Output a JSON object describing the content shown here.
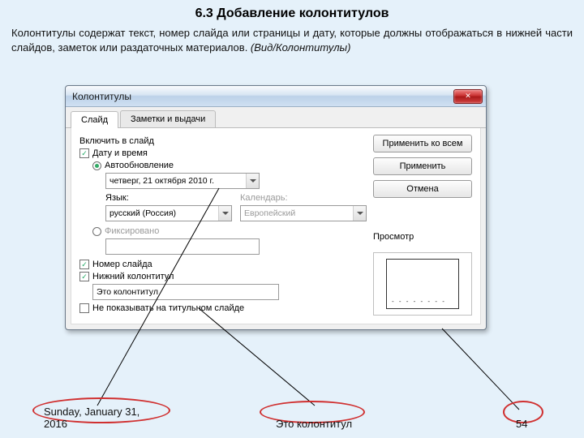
{
  "heading": "6.3 Добавление колонтитулов",
  "description": "Колонтитулы содержат текст, номер слайда или страницы и дату, которые должны отображаться в нижней части слайдов, заметок или раздаточных материалов. ",
  "ital": "(Вид/Колонтитулы)",
  "dialog": {
    "title": "Колонтитулы",
    "tabs": [
      "Слайд",
      "Заметки и выдачи"
    ],
    "include": "Включить в слайд",
    "datetime": "Дату и время",
    "auto": "Автообновление",
    "date_value": "четверг, 21 октября 2010 г.",
    "lang_label": "Язык:",
    "lang_value": "русский (Россия)",
    "cal_label": "Календарь:",
    "cal_value": "Европейский",
    "fixed": "Фиксировано",
    "slide_num": "Номер слайда",
    "footer": "Нижний колонтитул",
    "footer_value": "Это колонтитул",
    "hide_title": "Не показывать на титульном слайде",
    "apply_all": "Применить ко всем",
    "apply": "Применить",
    "cancel": "Отмена",
    "preview": "Просмотр",
    "dots": "- - - - - - - -"
  },
  "footers": {
    "date": "Sunday, January 31, 2016",
    "text": "Это колонтитул",
    "page": "54"
  }
}
